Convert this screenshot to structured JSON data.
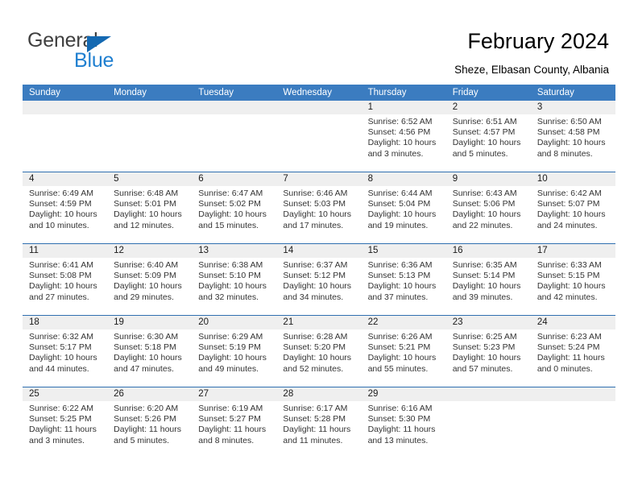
{
  "brand": {
    "name_top": "General",
    "name_bottom": "Blue",
    "accent_color": "#1f7fd0",
    "triangle_color": "#1469b2"
  },
  "header": {
    "title": "February 2024",
    "subtitle": "Sheze, Elbasan County, Albania"
  },
  "calendar": {
    "header_bg": "#3b7cc0",
    "day_band_bg": "#efefef",
    "weekdays": [
      "Sunday",
      "Monday",
      "Tuesday",
      "Wednesday",
      "Thursday",
      "Friday",
      "Saturday"
    ],
    "weeks": [
      [
        {
          "day": "",
          "sunrise": "",
          "sunset": "",
          "daylight1": "",
          "daylight2": ""
        },
        {
          "day": "",
          "sunrise": "",
          "sunset": "",
          "daylight1": "",
          "daylight2": ""
        },
        {
          "day": "",
          "sunrise": "",
          "sunset": "",
          "daylight1": "",
          "daylight2": ""
        },
        {
          "day": "",
          "sunrise": "",
          "sunset": "",
          "daylight1": "",
          "daylight2": ""
        },
        {
          "day": "1",
          "sunrise": "Sunrise: 6:52 AM",
          "sunset": "Sunset: 4:56 PM",
          "daylight1": "Daylight: 10 hours",
          "daylight2": "and 3 minutes."
        },
        {
          "day": "2",
          "sunrise": "Sunrise: 6:51 AM",
          "sunset": "Sunset: 4:57 PM",
          "daylight1": "Daylight: 10 hours",
          "daylight2": "and 5 minutes."
        },
        {
          "day": "3",
          "sunrise": "Sunrise: 6:50 AM",
          "sunset": "Sunset: 4:58 PM",
          "daylight1": "Daylight: 10 hours",
          "daylight2": "and 8 minutes."
        }
      ],
      [
        {
          "day": "4",
          "sunrise": "Sunrise: 6:49 AM",
          "sunset": "Sunset: 4:59 PM",
          "daylight1": "Daylight: 10 hours",
          "daylight2": "and 10 minutes."
        },
        {
          "day": "5",
          "sunrise": "Sunrise: 6:48 AM",
          "sunset": "Sunset: 5:01 PM",
          "daylight1": "Daylight: 10 hours",
          "daylight2": "and 12 minutes."
        },
        {
          "day": "6",
          "sunrise": "Sunrise: 6:47 AM",
          "sunset": "Sunset: 5:02 PM",
          "daylight1": "Daylight: 10 hours",
          "daylight2": "and 15 minutes."
        },
        {
          "day": "7",
          "sunrise": "Sunrise: 6:46 AM",
          "sunset": "Sunset: 5:03 PM",
          "daylight1": "Daylight: 10 hours",
          "daylight2": "and 17 minutes."
        },
        {
          "day": "8",
          "sunrise": "Sunrise: 6:44 AM",
          "sunset": "Sunset: 5:04 PM",
          "daylight1": "Daylight: 10 hours",
          "daylight2": "and 19 minutes."
        },
        {
          "day": "9",
          "sunrise": "Sunrise: 6:43 AM",
          "sunset": "Sunset: 5:06 PM",
          "daylight1": "Daylight: 10 hours",
          "daylight2": "and 22 minutes."
        },
        {
          "day": "10",
          "sunrise": "Sunrise: 6:42 AM",
          "sunset": "Sunset: 5:07 PM",
          "daylight1": "Daylight: 10 hours",
          "daylight2": "and 24 minutes."
        }
      ],
      [
        {
          "day": "11",
          "sunrise": "Sunrise: 6:41 AM",
          "sunset": "Sunset: 5:08 PM",
          "daylight1": "Daylight: 10 hours",
          "daylight2": "and 27 minutes."
        },
        {
          "day": "12",
          "sunrise": "Sunrise: 6:40 AM",
          "sunset": "Sunset: 5:09 PM",
          "daylight1": "Daylight: 10 hours",
          "daylight2": "and 29 minutes."
        },
        {
          "day": "13",
          "sunrise": "Sunrise: 6:38 AM",
          "sunset": "Sunset: 5:10 PM",
          "daylight1": "Daylight: 10 hours",
          "daylight2": "and 32 minutes."
        },
        {
          "day": "14",
          "sunrise": "Sunrise: 6:37 AM",
          "sunset": "Sunset: 5:12 PM",
          "daylight1": "Daylight: 10 hours",
          "daylight2": "and 34 minutes."
        },
        {
          "day": "15",
          "sunrise": "Sunrise: 6:36 AM",
          "sunset": "Sunset: 5:13 PM",
          "daylight1": "Daylight: 10 hours",
          "daylight2": "and 37 minutes."
        },
        {
          "day": "16",
          "sunrise": "Sunrise: 6:35 AM",
          "sunset": "Sunset: 5:14 PM",
          "daylight1": "Daylight: 10 hours",
          "daylight2": "and 39 minutes."
        },
        {
          "day": "17",
          "sunrise": "Sunrise: 6:33 AM",
          "sunset": "Sunset: 5:15 PM",
          "daylight1": "Daylight: 10 hours",
          "daylight2": "and 42 minutes."
        }
      ],
      [
        {
          "day": "18",
          "sunrise": "Sunrise: 6:32 AM",
          "sunset": "Sunset: 5:17 PM",
          "daylight1": "Daylight: 10 hours",
          "daylight2": "and 44 minutes."
        },
        {
          "day": "19",
          "sunrise": "Sunrise: 6:30 AM",
          "sunset": "Sunset: 5:18 PM",
          "daylight1": "Daylight: 10 hours",
          "daylight2": "and 47 minutes."
        },
        {
          "day": "20",
          "sunrise": "Sunrise: 6:29 AM",
          "sunset": "Sunset: 5:19 PM",
          "daylight1": "Daylight: 10 hours",
          "daylight2": "and 49 minutes."
        },
        {
          "day": "21",
          "sunrise": "Sunrise: 6:28 AM",
          "sunset": "Sunset: 5:20 PM",
          "daylight1": "Daylight: 10 hours",
          "daylight2": "and 52 minutes."
        },
        {
          "day": "22",
          "sunrise": "Sunrise: 6:26 AM",
          "sunset": "Sunset: 5:21 PM",
          "daylight1": "Daylight: 10 hours",
          "daylight2": "and 55 minutes."
        },
        {
          "day": "23",
          "sunrise": "Sunrise: 6:25 AM",
          "sunset": "Sunset: 5:23 PM",
          "daylight1": "Daylight: 10 hours",
          "daylight2": "and 57 minutes."
        },
        {
          "day": "24",
          "sunrise": "Sunrise: 6:23 AM",
          "sunset": "Sunset: 5:24 PM",
          "daylight1": "Daylight: 11 hours",
          "daylight2": "and 0 minutes."
        }
      ],
      [
        {
          "day": "25",
          "sunrise": "Sunrise: 6:22 AM",
          "sunset": "Sunset: 5:25 PM",
          "daylight1": "Daylight: 11 hours",
          "daylight2": "and 3 minutes."
        },
        {
          "day": "26",
          "sunrise": "Sunrise: 6:20 AM",
          "sunset": "Sunset: 5:26 PM",
          "daylight1": "Daylight: 11 hours",
          "daylight2": "and 5 minutes."
        },
        {
          "day": "27",
          "sunrise": "Sunrise: 6:19 AM",
          "sunset": "Sunset: 5:27 PM",
          "daylight1": "Daylight: 11 hours",
          "daylight2": "and 8 minutes."
        },
        {
          "day": "28",
          "sunrise": "Sunrise: 6:17 AM",
          "sunset": "Sunset: 5:28 PM",
          "daylight1": "Daylight: 11 hours",
          "daylight2": "and 11 minutes."
        },
        {
          "day": "29",
          "sunrise": "Sunrise: 6:16 AM",
          "sunset": "Sunset: 5:30 PM",
          "daylight1": "Daylight: 11 hours",
          "daylight2": "and 13 minutes."
        },
        {
          "day": "",
          "sunrise": "",
          "sunset": "",
          "daylight1": "",
          "daylight2": ""
        },
        {
          "day": "",
          "sunrise": "",
          "sunset": "",
          "daylight1": "",
          "daylight2": ""
        }
      ]
    ]
  }
}
